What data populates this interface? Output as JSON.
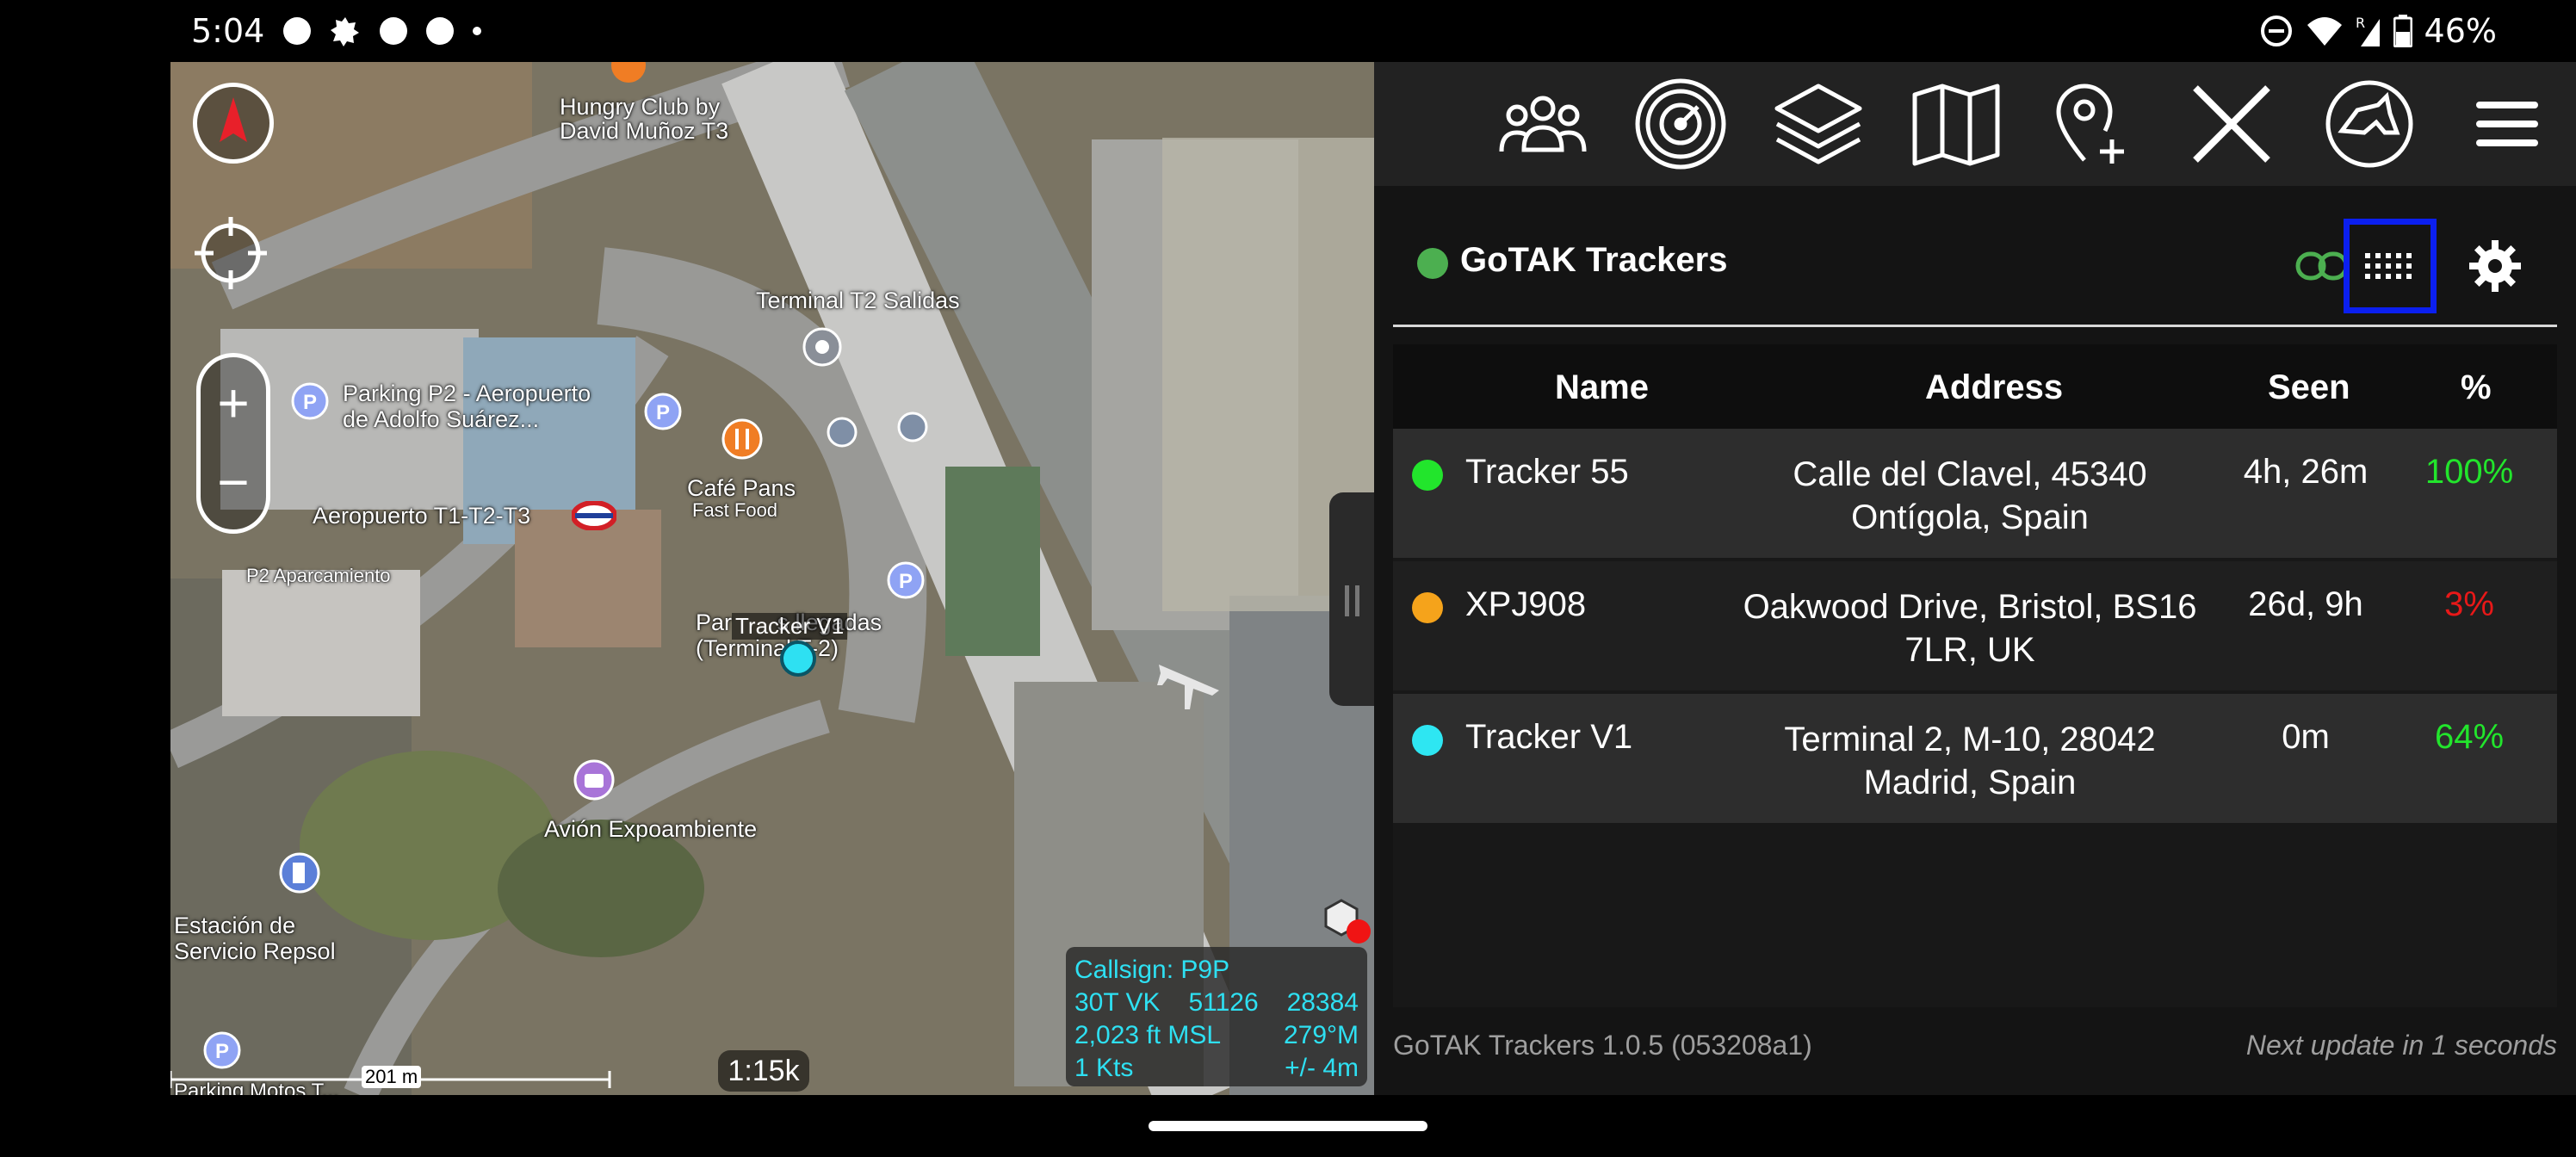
{
  "status_bar": {
    "time": "5:04",
    "battery": "46%",
    "icons": [
      "circle-icon",
      "badge-icon",
      "circle-icon",
      "circle-icon",
      "dot-icon",
      "dnd-icon",
      "wifi-icon",
      "signal-icon",
      "battery-icon"
    ]
  },
  "map": {
    "labels": {
      "hungry_club": "Hungry Club by\nDavid Muñoz T3",
      "terminal_t2_salidas": "Terminal T2 Salidas",
      "parking_p2": "Parking P2 - Aeropuerto\nde Adolfo Suárez...",
      "cafe_pans": "Café Pans",
      "fast_food": "Fast Food",
      "aeropuerto": "Aeropuerto T1-T2-T3",
      "p2_aparcamiento": "P2 Aparcamiento",
      "llegadas": "Par       s llegadas\n(Terminal T-2)",
      "avion": "Avión Expoambiente",
      "estacion": "Estación de\nServicio Repsol",
      "parking_bottom": "Parking Motos T..."
    },
    "tracker_label": "Tracker V1",
    "zoom_plus": "+",
    "zoom_minus": "−",
    "info": {
      "callsign": "Callsign: P9P",
      "mgrs_zone": "30T  VK",
      "easting": "51126",
      "northing": "28384",
      "altitude": "2,023 ft MSL",
      "heading": "279°M",
      "speed": "1 Kts",
      "accuracy": "+/- 4m"
    },
    "scale": "201 m",
    "zoom_level": "1:15k"
  },
  "toolbar": {
    "icons": [
      "contacts-icon",
      "radar-icon",
      "layers-icon",
      "map-icon",
      "add-point-icon",
      "close-tool-icon",
      "dog-icon",
      "menu-icon"
    ]
  },
  "panel": {
    "title": "GoTAK Trackers",
    "columns": {
      "name": "Name",
      "address": "Address",
      "seen": "Seen",
      "percent": "%"
    },
    "rows": [
      {
        "name": "Tracker 55",
        "address": "Calle del Clavel, 45340 Ontígola, Spain",
        "seen": "4h, 26m",
        "percent": "100%",
        "dot_color": "#22e52c",
        "percent_color": "#22e52c"
      },
      {
        "name": "XPJ908",
        "address": "Oakwood Drive, Bristol, BS16 7LR, UK",
        "seen": "26d, 9h",
        "percent": "3%",
        "dot_color": "#f5a31b",
        "percent_color": "#e81818"
      },
      {
        "name": "Tracker V1",
        "address": "Terminal 2, M-10, 28042 Madrid, Spain",
        "seen": "0m",
        "percent": "64%",
        "dot_color": "#2ee6f2",
        "percent_color": "#22e52c"
      }
    ],
    "footer_version": "GoTAK Trackers 1.0.5 (053208a1)",
    "footer_update": "Next update in 1 seconds"
  },
  "colors": {
    "connected": "#4caf50",
    "highlight_box": "#0b1fef",
    "link": "#4caf50"
  }
}
